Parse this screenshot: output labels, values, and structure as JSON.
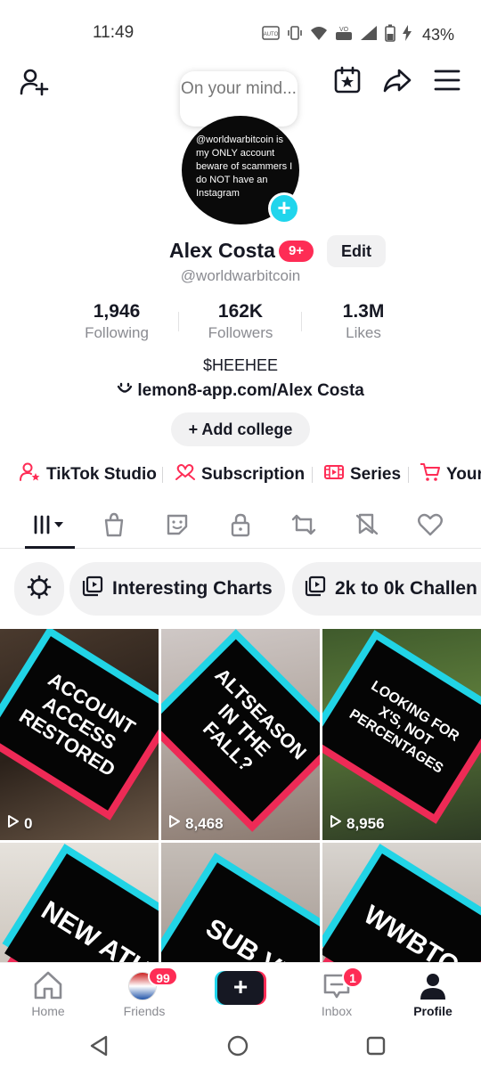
{
  "status_bar": {
    "time": "11:49",
    "battery": "43%"
  },
  "bubble": {
    "text": "On your mind..."
  },
  "avatar": {
    "caption": "@worldwarbitcoin is my ONLY account beware of scammers I do NOT have an Instagram"
  },
  "profile": {
    "name": "Alex Costa",
    "notification_badge": "9+",
    "edit_label": "Edit",
    "username": "@worldwarbitcoin",
    "bio": "$HEEHEE",
    "link": "lemon8-app.com/Alex Costa",
    "add_college_label": "Add college"
  },
  "stats": [
    {
      "value": "1,946",
      "label": "Following"
    },
    {
      "value": "162K",
      "label": "Followers"
    },
    {
      "value": "1.3M",
      "label": "Likes"
    }
  ],
  "quick_links": [
    {
      "label": "TikTok Studio",
      "icon": "person-star-icon"
    },
    {
      "label": "Subscription",
      "icon": "hand-heart-icon"
    },
    {
      "label": "Series",
      "icon": "film-icon"
    },
    {
      "label": "Your",
      "icon": "cart-icon"
    }
  ],
  "tabs": [
    "videos",
    "shop",
    "sticker",
    "private",
    "reposts",
    "favorites-hidden",
    "liked"
  ],
  "playlists": {
    "items": [
      "Interesting Charts",
      "2k to 0k Challen"
    ]
  },
  "videos": [
    {
      "caption": "ACCOUNT ACCESS RESTORED",
      "views": "0"
    },
    {
      "caption": "ALTSEASON IN THE FALL?",
      "views": "8,468"
    },
    {
      "caption": "LOOKING FOR X'S, NOT PERCENTAGES",
      "views": "8,956"
    },
    {
      "caption": "NEW ATH",
      "views": ""
    },
    {
      "caption": "SUB VI",
      "views": ""
    },
    {
      "caption": "WWBTC",
      "views": ""
    }
  ],
  "bottom_nav": {
    "home": "Home",
    "friends": "Friends",
    "friends_badge": "99",
    "inbox": "Inbox",
    "inbox_badge": "1",
    "profile": "Profile"
  },
  "colors": {
    "accent_red": "#fe2c55",
    "accent_cyan": "#20d5ec",
    "text_primary": "#161823",
    "text_secondary": "#8a8b91"
  }
}
